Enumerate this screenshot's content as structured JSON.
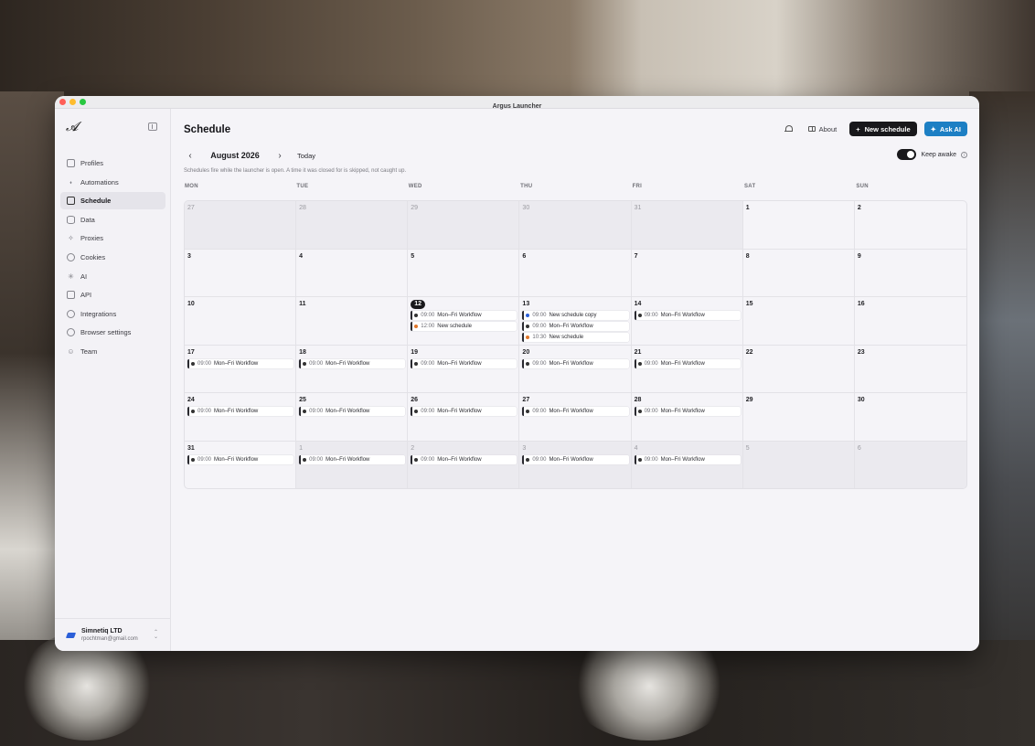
{
  "window": {
    "title": "Argus Launcher"
  },
  "sidebar": {
    "items": [
      {
        "label": "Profiles",
        "icon": "monitor-icon",
        "active": false
      },
      {
        "label": "Automations",
        "icon": "workflow-icon",
        "active": false
      },
      {
        "label": "Schedule",
        "icon": "calendar-icon",
        "active": true
      },
      {
        "label": "Data",
        "icon": "database-icon",
        "active": false
      },
      {
        "label": "Proxies",
        "icon": "proxy-icon",
        "active": false
      },
      {
        "label": "Cookies",
        "icon": "cookie-icon",
        "active": false
      },
      {
        "label": "AI",
        "icon": "sparkle-icon",
        "active": false
      },
      {
        "label": "API",
        "icon": "api-icon",
        "active": false
      },
      {
        "label": "Integrations",
        "icon": "integrations-icon",
        "active": false
      },
      {
        "label": "Browser settings",
        "icon": "globe-icon",
        "active": false
      },
      {
        "label": "Team",
        "icon": "team-icon",
        "active": false
      }
    ],
    "account": {
      "name": "Simnetiq LTD",
      "email": "rpochtman@gmail.com"
    }
  },
  "header": {
    "title": "Schedule",
    "about_label": "About",
    "new_schedule_label": "New schedule",
    "ask_ai_label": "Ask AI",
    "colors": {
      "new_schedule_bg": "#18181b",
      "ask_ai_bg": "#1d7fc4"
    }
  },
  "calendar": {
    "month_label": "August 2026",
    "today_label": "Today",
    "keep_awake_label": "Keep awake",
    "keep_awake_on": true,
    "hint": "Schedules fire while the launcher is open. A time it was closed for is skipped, not caught up.",
    "weekdays": [
      "MON",
      "TUE",
      "WED",
      "THU",
      "FRI",
      "SAT",
      "SUN"
    ],
    "weeks": [
      [
        {
          "num": "27",
          "out": true,
          "events": []
        },
        {
          "num": "28",
          "out": true,
          "events": []
        },
        {
          "num": "29",
          "out": true,
          "events": []
        },
        {
          "num": "30",
          "out": true,
          "events": []
        },
        {
          "num": "31",
          "out": true,
          "events": []
        },
        {
          "num": "1",
          "out": false,
          "events": []
        },
        {
          "num": "2",
          "out": false,
          "events": []
        }
      ],
      [
        {
          "num": "3",
          "out": false,
          "events": []
        },
        {
          "num": "4",
          "out": false,
          "events": []
        },
        {
          "num": "5",
          "out": false,
          "events": []
        },
        {
          "num": "6",
          "out": false,
          "events": []
        },
        {
          "num": "7",
          "out": false,
          "events": []
        },
        {
          "num": "8",
          "out": false,
          "events": []
        },
        {
          "num": "9",
          "out": false,
          "events": []
        }
      ],
      [
        {
          "num": "10",
          "out": false,
          "events": []
        },
        {
          "num": "11",
          "out": false,
          "events": []
        },
        {
          "num": "12",
          "out": false,
          "today": true,
          "events": [
            {
              "time": "09:00",
              "name": "Mon–Fri Workflow",
              "color": "#333333"
            },
            {
              "time": "12:00",
              "name": "New schedule",
              "color": "#e0762b"
            }
          ]
        },
        {
          "num": "13",
          "out": false,
          "events": [
            {
              "time": "09:00",
              "name": "New schedule copy",
              "color": "#2b5fd8"
            },
            {
              "time": "09:00",
              "name": "Mon–Fri Workflow",
              "color": "#333333"
            },
            {
              "time": "10:30",
              "name": "New schedule",
              "color": "#e0762b"
            }
          ]
        },
        {
          "num": "14",
          "out": false,
          "events": [
            {
              "time": "09:00",
              "name": "Mon–Fri Workflow",
              "color": "#333333"
            }
          ]
        },
        {
          "num": "15",
          "out": false,
          "events": []
        },
        {
          "num": "16",
          "out": false,
          "events": []
        }
      ],
      [
        {
          "num": "17",
          "out": false,
          "events": [
            {
              "time": "09:00",
              "name": "Mon–Fri Workflow",
              "color": "#333333"
            }
          ]
        },
        {
          "num": "18",
          "out": false,
          "events": [
            {
              "time": "09:00",
              "name": "Mon–Fri Workflow",
              "color": "#333333"
            }
          ]
        },
        {
          "num": "19",
          "out": false,
          "events": [
            {
              "time": "09:00",
              "name": "Mon–Fri Workflow",
              "color": "#333333"
            }
          ]
        },
        {
          "num": "20",
          "out": false,
          "events": [
            {
              "time": "09:00",
              "name": "Mon–Fri Workflow",
              "color": "#333333"
            }
          ]
        },
        {
          "num": "21",
          "out": false,
          "events": [
            {
              "time": "09:00",
              "name": "Mon–Fri Workflow",
              "color": "#333333"
            }
          ]
        },
        {
          "num": "22",
          "out": false,
          "events": []
        },
        {
          "num": "23",
          "out": false,
          "events": []
        }
      ],
      [
        {
          "num": "24",
          "out": false,
          "events": [
            {
              "time": "09:00",
              "name": "Mon–Fri Workflow",
              "color": "#333333"
            }
          ]
        },
        {
          "num": "25",
          "out": false,
          "events": [
            {
              "time": "09:00",
              "name": "Mon–Fri Workflow",
              "color": "#333333"
            }
          ]
        },
        {
          "num": "26",
          "out": false,
          "events": [
            {
              "time": "09:00",
              "name": "Mon–Fri Workflow",
              "color": "#333333"
            }
          ]
        },
        {
          "num": "27",
          "out": false,
          "events": [
            {
              "time": "09:00",
              "name": "Mon–Fri Workflow",
              "color": "#333333"
            }
          ]
        },
        {
          "num": "28",
          "out": false,
          "events": [
            {
              "time": "09:00",
              "name": "Mon–Fri Workflow",
              "color": "#333333"
            }
          ]
        },
        {
          "num": "29",
          "out": false,
          "events": []
        },
        {
          "num": "30",
          "out": false,
          "events": []
        }
      ],
      [
        {
          "num": "31",
          "out": false,
          "events": [
            {
              "time": "09:00",
              "name": "Mon–Fri Workflow",
              "color": "#333333"
            }
          ]
        },
        {
          "num": "1",
          "out": true,
          "events": [
            {
              "time": "09:00",
              "name": "Mon–Fri Workflow",
              "color": "#333333"
            }
          ]
        },
        {
          "num": "2",
          "out": true,
          "events": [
            {
              "time": "09:00",
              "name": "Mon–Fri Workflow",
              "color": "#333333"
            }
          ]
        },
        {
          "num": "3",
          "out": true,
          "events": [
            {
              "time": "09:00",
              "name": "Mon–Fri Workflow",
              "color": "#333333"
            }
          ]
        },
        {
          "num": "4",
          "out": true,
          "events": [
            {
              "time": "09:00",
              "name": "Mon–Fri Workflow",
              "color": "#333333"
            }
          ]
        },
        {
          "num": "5",
          "out": true,
          "events": []
        },
        {
          "num": "6",
          "out": true,
          "events": []
        }
      ]
    ]
  }
}
